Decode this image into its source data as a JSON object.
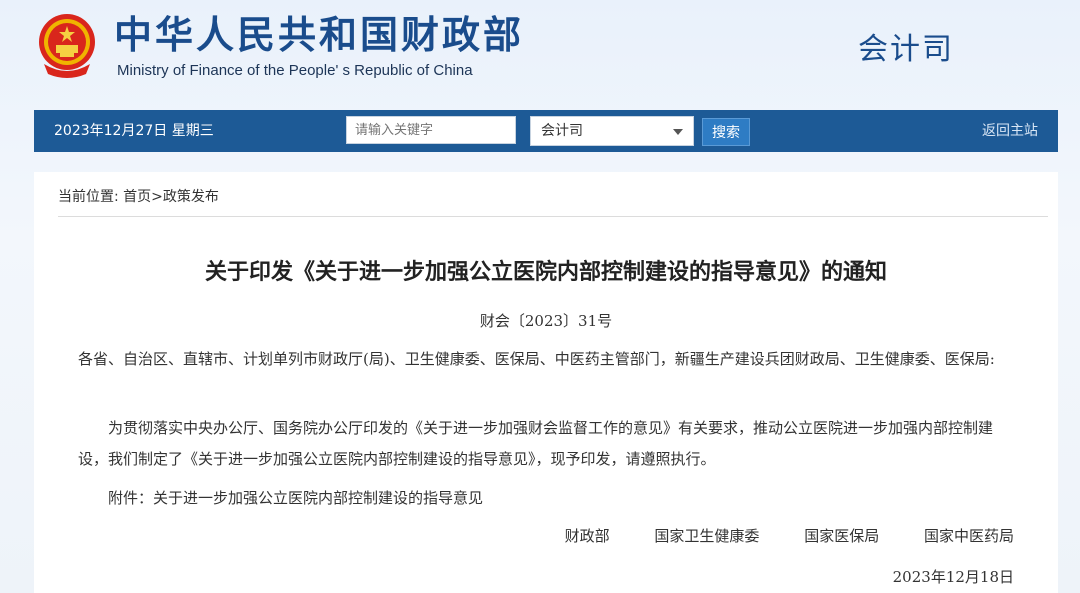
{
  "header": {
    "title_cn": "中华人民共和国财政部",
    "title_en": "Ministry of Finance of the People' s Republic of China",
    "department": "会计司",
    "emblem_icon": "national-emblem-icon"
  },
  "navbar": {
    "date": "2023年12月27日  星期三",
    "search_placeholder": "请输入关键字",
    "select_value": "会计司",
    "search_button": "搜索",
    "home_link": "返回主站",
    "bg_color": "#1d5a96"
  },
  "breadcrumb": {
    "label": "当前位置:",
    "home": "首页",
    "sep": ">",
    "current": "政策发布"
  },
  "document": {
    "title": "关于印发《关于进一步加强公立医院内部控制建设的指导意见》的通知",
    "number": "财会〔2023〕31号",
    "salutation": "各省、自治区、直辖市、计划单列市财政厅(局)、卫生健康委、医保局、中医药主管部门，新疆生产建设兵团财政局、卫生健康委、医保局:",
    "paragraph": "为贯彻落实中央办公厅、国务院办公厅印发的《关于进一步加强财会监督工作的意见》有关要求，推动公立医院进一步加强内部控制建设，我们制定了《关于进一步加强公立医院内部控制建设的指导意见》，现予印发，请遵照执行。",
    "attachment": "附件：关于进一步加强公立医院内部控制建设的指导意见",
    "signers": [
      "财政部",
      "国家卫生健康委",
      "国家医保局",
      "国家中医药局"
    ],
    "date": "2023年12月18日"
  }
}
